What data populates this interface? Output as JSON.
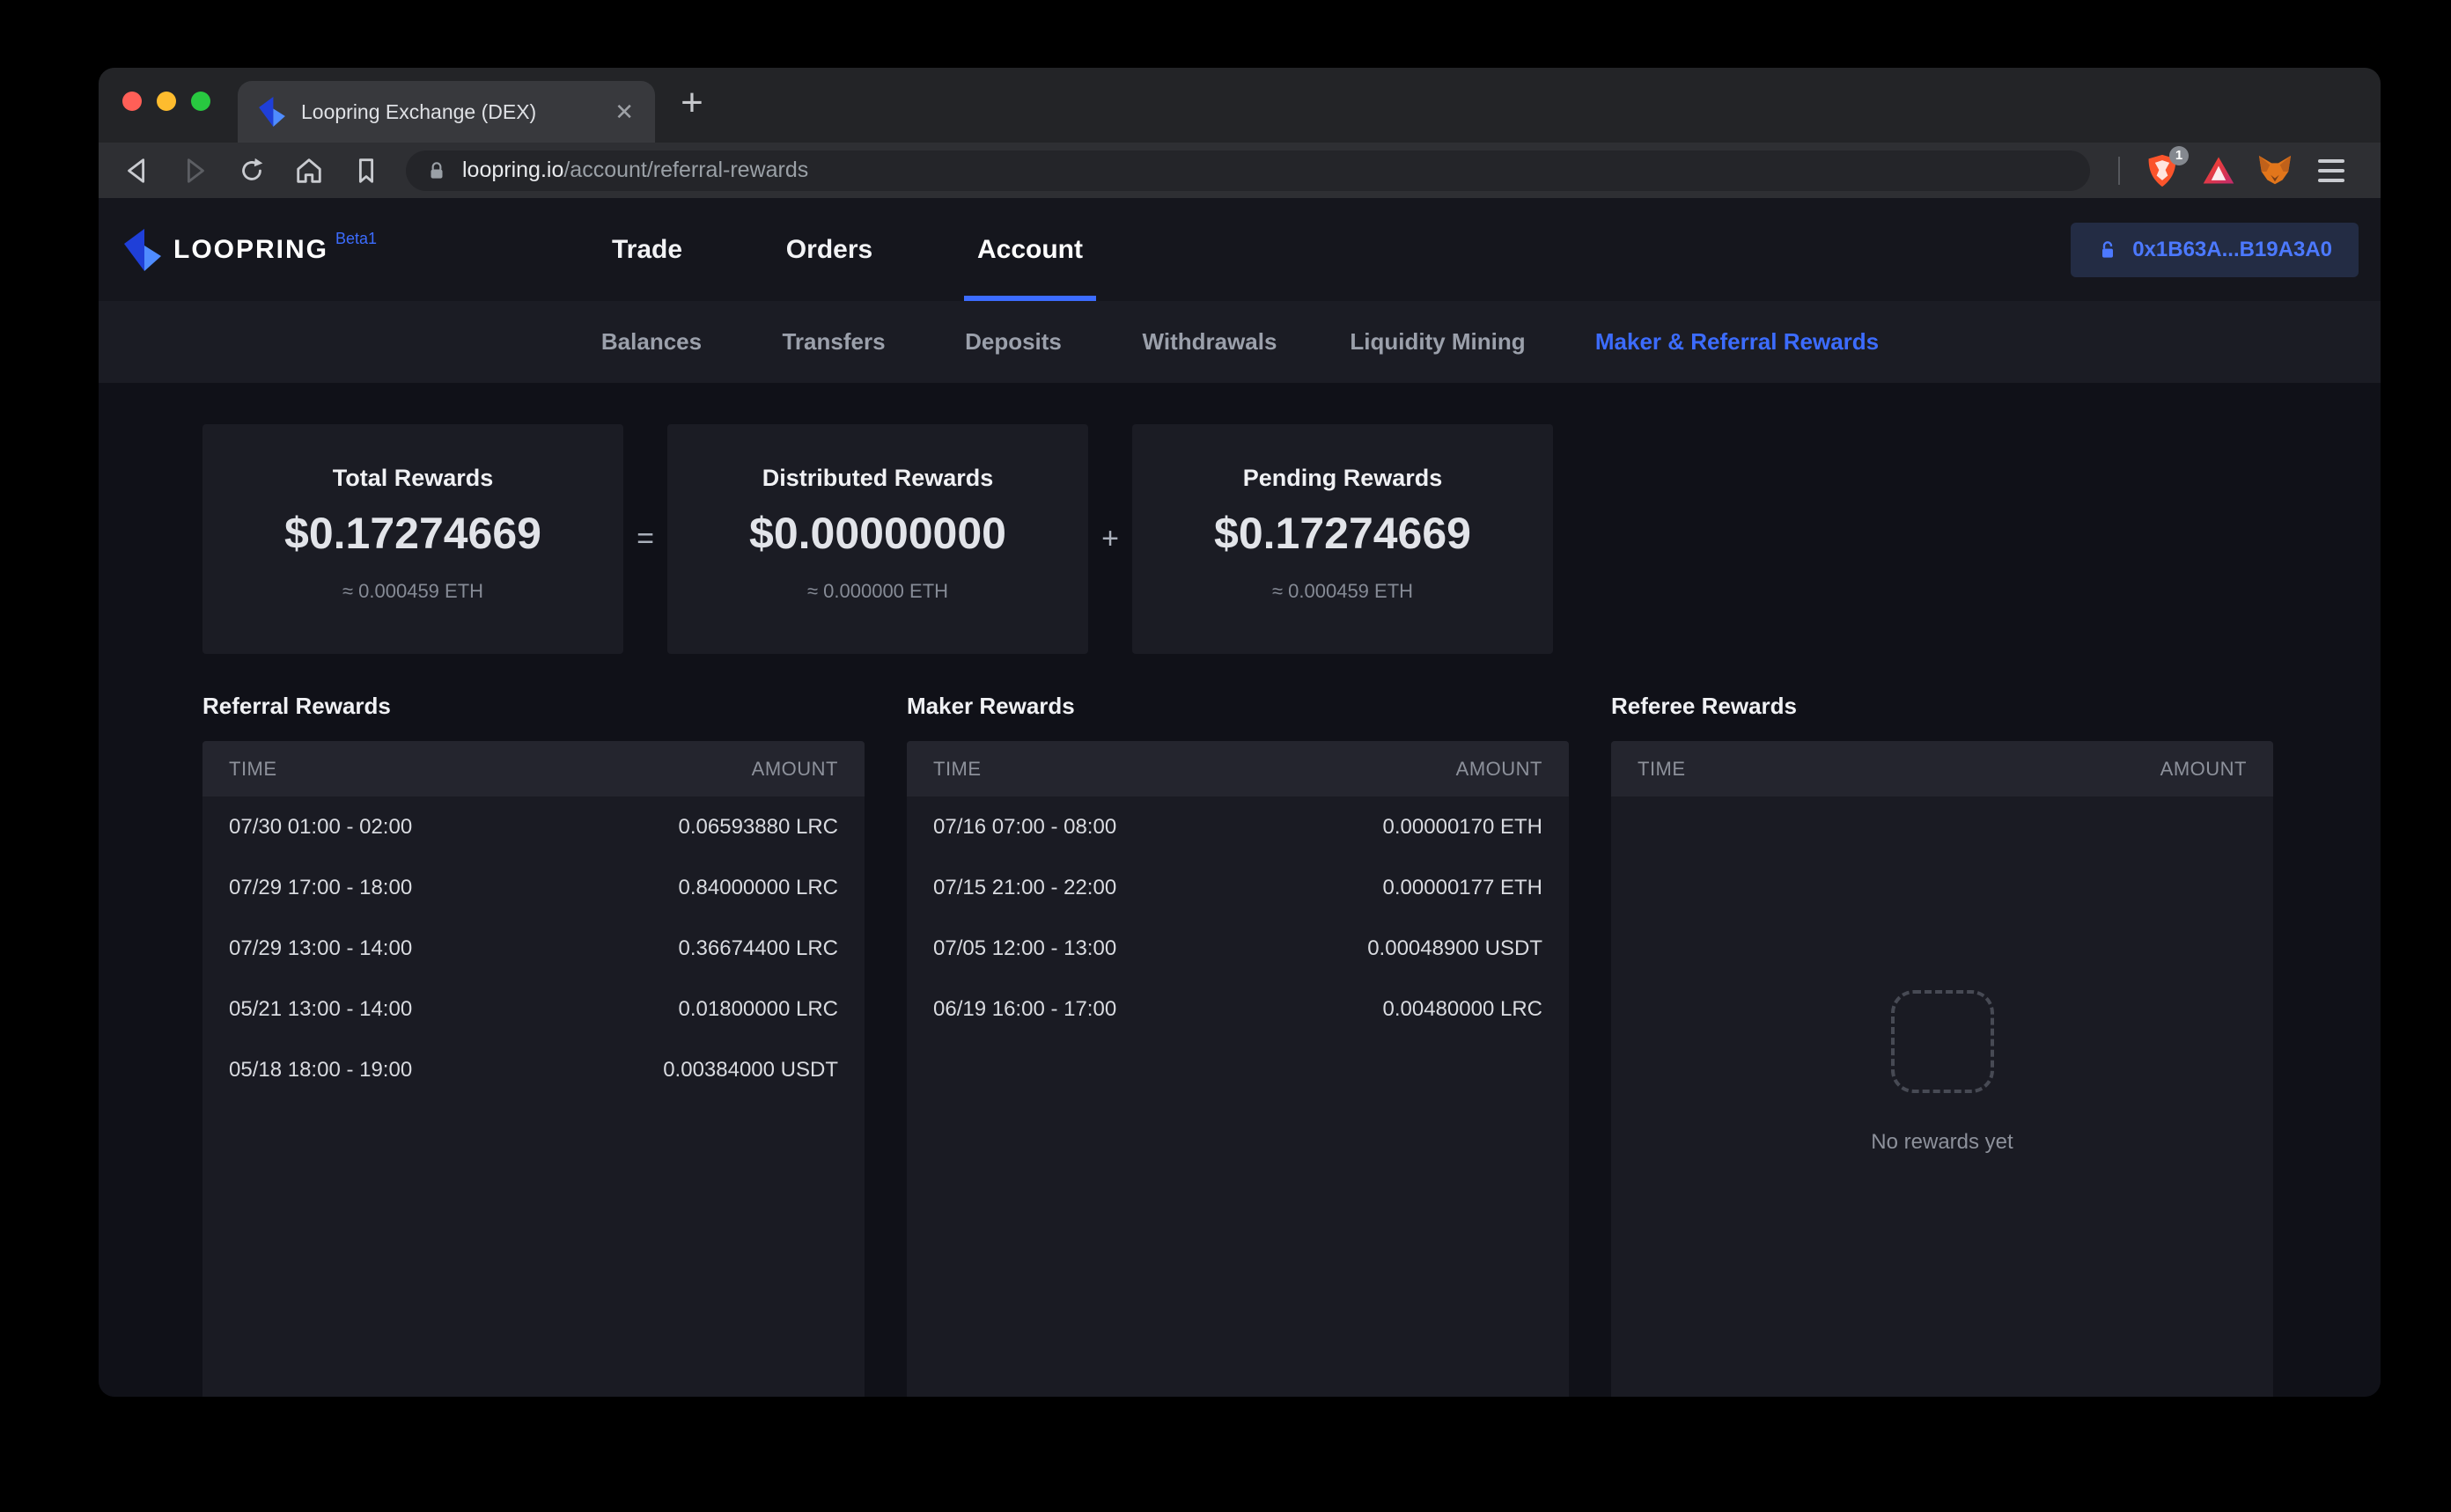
{
  "colors": {
    "accent": "#3c6cff",
    "brave_orange": "#fb542b",
    "metamask_orange": "#e2761b"
  },
  "browser": {
    "tab": {
      "title": "Loopring Exchange (DEX)",
      "close_glyph": "✕",
      "new_tab_glyph": "+"
    },
    "toolbar": {
      "url_host": "loopring.io",
      "url_path": "/account/referral-rewards",
      "shield_badge": "1"
    }
  },
  "header": {
    "brand": "LOOPRING",
    "beta": "Beta1",
    "nav": [
      {
        "label": "Trade"
      },
      {
        "label": "Orders"
      },
      {
        "label": "Account",
        "active": true
      }
    ],
    "wallet_address": "0x1B63A...B19A3A0"
  },
  "subnav": {
    "items": [
      {
        "label": "Balances"
      },
      {
        "label": "Transfers"
      },
      {
        "label": "Deposits"
      },
      {
        "label": "Withdrawals"
      },
      {
        "label": "Liquidity Mining"
      },
      {
        "label": "Maker & Referral Rewards",
        "active": true
      }
    ]
  },
  "stats": {
    "op_equals": "=",
    "op_plus": "+",
    "cards": [
      {
        "title": "Total Rewards",
        "value": "$0.17274669",
        "eth": "≈ 0.000459 ETH"
      },
      {
        "title": "Distributed Rewards",
        "value": "$0.00000000",
        "eth": "≈ 0.000000 ETH"
      },
      {
        "title": "Pending Rewards",
        "value": "$0.17274669",
        "eth": "≈ 0.000459 ETH"
      }
    ]
  },
  "tables": {
    "col_time": "TIME",
    "col_amount": "AMOUNT",
    "referral": {
      "title": "Referral Rewards",
      "rows": [
        {
          "time": "07/30 01:00 - 02:00",
          "amount": "0.06593880 LRC"
        },
        {
          "time": "07/29 17:00 - 18:00",
          "amount": "0.84000000 LRC"
        },
        {
          "time": "07/29 13:00 - 14:00",
          "amount": "0.36674400 LRC"
        },
        {
          "time": "05/21 13:00 - 14:00",
          "amount": "0.01800000 LRC"
        },
        {
          "time": "05/18 18:00 - 19:00",
          "amount": "0.00384000 USDT"
        }
      ]
    },
    "maker": {
      "title": "Maker Rewards",
      "rows": [
        {
          "time": "07/16 07:00 - 08:00",
          "amount": "0.00000170 ETH"
        },
        {
          "time": "07/15 21:00 - 22:00",
          "amount": "0.00000177 ETH"
        },
        {
          "time": "07/05 12:00 - 13:00",
          "amount": "0.00048900 USDT"
        },
        {
          "time": "06/19 16:00 - 17:00",
          "amount": "0.00480000 LRC"
        }
      ]
    },
    "referee": {
      "title": "Referee Rewards",
      "rows": [],
      "empty_text": "No rewards yet"
    }
  }
}
